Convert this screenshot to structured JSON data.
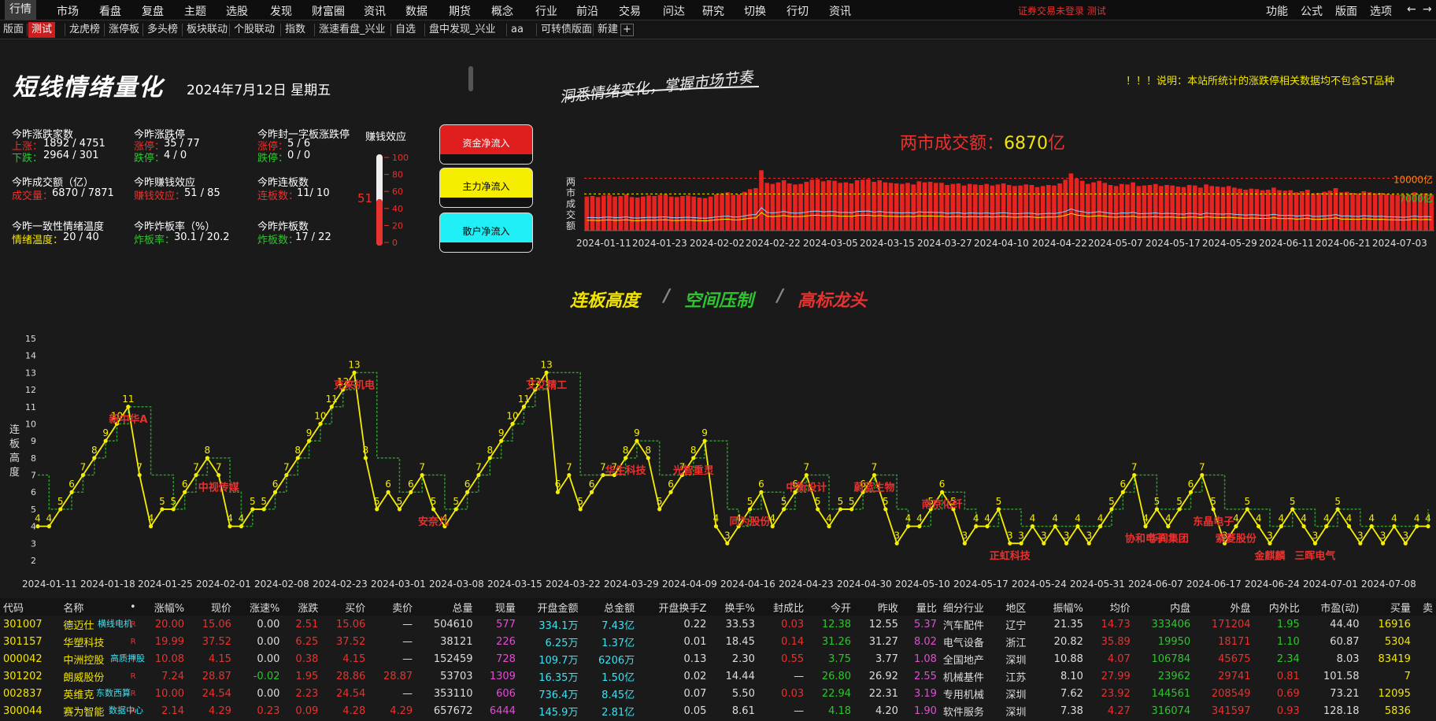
{
  "menubar": {
    "left": [
      "行情",
      "市场",
      "看盘",
      "复盘",
      "主题",
      "选股",
      "发现",
      "财富圈",
      "资讯",
      "数据",
      "期货",
      "概念",
      "行业",
      "前沿",
      "交易",
      "问达",
      "研究",
      "切换",
      "行切",
      "资讯"
    ],
    "status": "证券交易未登录  测试",
    "right": [
      "功能",
      "公式",
      "版面",
      "选项"
    ],
    "back_glyph": "←",
    "fwd_glyph": "→"
  },
  "tabbar": {
    "tabs": [
      "版面",
      "测试",
      "龙虎榜",
      "涨停板",
      "多头榜",
      "板块联动",
      "个股联动",
      "指数",
      "涨速看盘_兴业",
      "自选",
      "盘中发现_兴业",
      "aa",
      "可转债版面",
      "新建"
    ],
    "selected": 1,
    "add_glyph": "+"
  },
  "header": {
    "title": "短线情绪量化",
    "date": "2024年7月12日 星期五",
    "slogan": "洞悉情绪变化，掌握市场节奏",
    "notice": "！！！说明：本站所统计的涨跌停相关数据均不包含ST品种"
  },
  "stats": {
    "rise_fall": {
      "title": "今昨涨跌家数",
      "l1": "上涨：",
      "v1": "1892 / 4751",
      "l2": "下跌：",
      "v2": "2964 / 301"
    },
    "limit": {
      "title": "今昨涨跌停",
      "l1": "涨停：",
      "v1": "35 / 77",
      "l2": "跌停：",
      "v2": "4 / 0"
    },
    "limit_seal": {
      "title": "今昨封一字板涨跌停",
      "l1": "涨停：",
      "v1": "5 / 6",
      "l2": "跌停：",
      "v2": "0 / 0"
    },
    "turnover": {
      "title": "今昨成交额（亿）",
      "l1": "成交量：",
      "v1": "6870 / 7871"
    },
    "money_effect": {
      "title": "今昨赚钱效应",
      "l1": "赚钱效应：",
      "v1": "51 / 85"
    },
    "consec": {
      "title": "今昨连板数",
      "l1": "连板数：",
      "v1": "11/ 10"
    },
    "consistency": {
      "title": "今昨一致性情绪温度",
      "l1": "情绪温度：",
      "v1": "20 / 40"
    },
    "broken_rate": {
      "title": "今昨炸板率（%）",
      "l1": "炸板率：",
      "v1": "30.1 / 20.2"
    },
    "broken": {
      "title": "今昨炸板数",
      "l1": "炸板数：",
      "v1": "17 / 22"
    }
  },
  "gauge": {
    "title": "赚钱效应",
    "value": 51,
    "ticks": [
      "100",
      "80",
      "60",
      "40",
      "20",
      "0"
    ],
    "fill_color": "#e8322f"
  },
  "flows": [
    {
      "label": "资金净流入",
      "bg": "#e01e1e",
      "fg": "#ffffff"
    },
    {
      "label": "主力净流入",
      "bg": "#f5ee00",
      "fg": "#000000"
    },
    {
      "label": "散户净流入",
      "bg": "#1ef0f5",
      "fg": "#000000"
    }
  ],
  "sections": {
    "t1": "连板高度",
    "sep": "/",
    "t2": "空间压制",
    "t3": "高标龙头"
  },
  "chart_data": [
    {
      "type": "bar",
      "title": "两市成交额：",
      "title_value": "6870",
      "title_unit": "亿",
      "ylabel": "两市成交额",
      "ref_lines": [
        {
          "value": 10000,
          "label": "10000亿"
        },
        {
          "value": 7000,
          "label": "7000亿"
        }
      ],
      "ylim": [
        0,
        12000
      ],
      "x_ticks": [
        "2024-01-11",
        "2024-01-23",
        "2024-02-02",
        "2024-02-22",
        "2024-03-05",
        "2024-03-15",
        "2024-03-27",
        "2024-04-10",
        "2024-04-22",
        "2024-05-07",
        "2024-05-17",
        "2024-05-29",
        "2024-06-11",
        "2024-06-21",
        "2024-07-03"
      ],
      "values": [
        6500,
        6600,
        6400,
        6700,
        6800,
        6500,
        6600,
        6900,
        6400,
        6300,
        6500,
        6700,
        6600,
        6800,
        6900,
        6500,
        6400,
        6600,
        6700,
        6500,
        6300,
        6200,
        6500,
        6900,
        7100,
        7300,
        6800,
        6900,
        7400,
        7900,
        8100,
        11500,
        9100,
        8900,
        9200,
        9600,
        9000,
        8800,
        8900,
        9300,
        9700,
        9800,
        9400,
        9600,
        9500,
        9100,
        9200,
        9000,
        9600,
        9700,
        9800,
        9300,
        9600,
        9200,
        9100,
        9000,
        8900,
        9100,
        8800,
        9400,
        9200,
        9300,
        9100,
        9100,
        8700,
        8900,
        9000,
        8600,
        8900,
        8800,
        8700,
        8900,
        8600,
        8800,
        9000,
        8700,
        8500,
        8600,
        8800,
        8700,
        8300,
        8500,
        8700,
        8600,
        9000,
        9700,
        10900,
        9900,
        9500,
        8900,
        9200,
        9500,
        9100,
        8700,
        8500,
        8900,
        8800,
        9200,
        8500,
        8600,
        8700,
        8900,
        8500,
        8700,
        8600,
        8400,
        8300,
        8700,
        8600,
        8200,
        8800,
        8500,
        8400,
        8300,
        8500,
        8200,
        8000,
        7800,
        8000,
        7900,
        7700,
        7800,
        8200,
        7700,
        7600,
        7700,
        7300,
        7500,
        7800,
        7100,
        7200,
        7400,
        7600,
        8100,
        7300,
        7400,
        7200,
        7100,
        7500,
        7300,
        7100,
        7200,
        7000,
        6900,
        6800,
        6700,
        6900,
        7300,
        6900,
        7100,
        6870
      ]
    },
    {
      "type": "line",
      "ylabel": "连板高度",
      "ylim": [
        2,
        15
      ],
      "y_ticks": [
        "15",
        "14",
        "13",
        "12",
        "11",
        "10",
        "9",
        "8",
        "7",
        "6",
        "5",
        "4",
        "3",
        "2"
      ],
      "x_ticks": [
        "2024-01-11",
        "2024-01-18",
        "2024-01-25",
        "2024-02-01",
        "2024-02-08",
        "2024-02-23",
        "2024-03-01",
        "2024-03-08",
        "2024-03-15",
        "2024-03-22",
        "2024-03-29",
        "2024-04-09",
        "2024-04-16",
        "2024-04-23",
        "2024-04-30",
        "2024-05-10",
        "2024-05-17",
        "2024-05-24",
        "2024-05-31",
        "2024-06-07",
        "2024-06-17",
        "2024-06-24",
        "2024-07-01",
        "2024-07-08"
      ],
      "series": [
        {
          "color": "#f5ee00",
          "values": [
            4,
            4,
            5,
            6,
            7,
            8,
            9,
            10,
            11,
            7,
            4,
            5,
            5,
            6,
            7,
            8,
            7,
            4,
            4,
            5,
            5,
            6,
            7,
            8,
            9,
            10,
            11,
            12,
            13,
            8,
            5,
            6,
            5,
            6,
            7,
            5,
            4,
            5,
            6,
            7,
            8,
            9,
            10,
            11,
            12,
            13,
            6,
            7,
            5,
            6,
            7,
            7,
            8,
            9,
            8,
            5,
            6,
            7,
            8,
            9,
            4,
            3,
            4,
            5,
            6,
            4,
            5,
            6,
            7,
            5,
            4,
            5,
            5,
            6,
            7,
            5,
            3,
            4,
            4,
            5,
            6,
            5,
            3,
            4,
            4,
            5,
            3,
            3,
            4,
            3,
            4,
            3,
            4,
            3,
            4,
            5,
            6,
            7,
            4,
            5,
            4,
            5,
            6,
            7,
            5,
            3,
            4,
            5,
            4,
            3,
            4,
            5,
            4,
            3,
            4,
            5,
            4,
            3,
            4,
            3,
            4,
            3,
            4,
            4
          ]
        },
        {
          "color": "#2a9a2a",
          "values": [
            7,
            5,
            5,
            6,
            7,
            8,
            9,
            10,
            11,
            11,
            7,
            7,
            5,
            6,
            7,
            8,
            8,
            6,
            4,
            5,
            5,
            6,
            7,
            8,
            9,
            10,
            11,
            12,
            13,
            13,
            8,
            8,
            6,
            6,
            7,
            7,
            5,
            5,
            6,
            7,
            8,
            9,
            10,
            11,
            12,
            13,
            13,
            13,
            7,
            7,
            7,
            7,
            8,
            9,
            9,
            7,
            7,
            7,
            8,
            9,
            9,
            5,
            4,
            5,
            6,
            6,
            5,
            6,
            7,
            7,
            5,
            5,
            5,
            6,
            7,
            7,
            5,
            4,
            4,
            5,
            6,
            6,
            5,
            4,
            4,
            5,
            5,
            4,
            4,
            4,
            4,
            4,
            4,
            4,
            4,
            5,
            6,
            7,
            7,
            5,
            5,
            5,
            6,
            7,
            7,
            5,
            5,
            5,
            5,
            4,
            4,
            5,
            5,
            4,
            4,
            5,
            5,
            4,
            4,
            4,
            4,
            4,
            4,
            5
          ]
        }
      ],
      "labels": [
        {
          "i": 8,
          "text": "新中华A"
        },
        {
          "i": 16,
          "text": "中视传媒"
        },
        {
          "i": 28,
          "text": "克来机电"
        },
        {
          "i": 35,
          "text": "安奈儿"
        },
        {
          "i": 45,
          "text": "艾艾精工"
        },
        {
          "i": 52,
          "text": "华生科技"
        },
        {
          "i": 58,
          "text": "光智重灵"
        },
        {
          "i": 63,
          "text": "同为股份"
        },
        {
          "i": 68,
          "text": "中衡设计"
        },
        {
          "i": 74,
          "text": "蔚蓝生物"
        },
        {
          "i": 80,
          "text": "南京化纤"
        },
        {
          "i": 86,
          "text": "正虹科技"
        },
        {
          "i": 98,
          "text": "协和电子"
        },
        {
          "i": 100,
          "text": "华闻集团"
        },
        {
          "i": 104,
          "text": "东晶电子"
        },
        {
          "i": 106,
          "text": "索菱股份"
        },
        {
          "i": 109,
          "text": "金麒麟"
        },
        {
          "i": 113,
          "text": "三晖电气"
        }
      ]
    }
  ],
  "table": {
    "headers": [
      "代码",
      "名称",
      "•",
      "涨幅%",
      "现价",
      "涨速%",
      "涨跌",
      "买价",
      "卖价",
      "总量",
      "现量",
      "开盘金额",
      "总金额",
      "开盘换手Z",
      "换手%",
      "封成比",
      "今开",
      "昨收",
      "量比",
      "细分行业",
      "地区",
      "振幅%",
      "均价",
      "内盘",
      "外盘",
      "内外比",
      "市盈(动)",
      "买量",
      "卖"
    ],
    "overlays": [
      "横线电机",
      "高质押股",
      "东数西算",
      "数据中心"
    ],
    "rows": [
      [
        "301007",
        "德迈仕",
        "R",
        "20.00",
        "15.06",
        "0.00",
        "2.51",
        "15.06",
        "—",
        "504610",
        "577",
        "334.1万",
        "7.43亿",
        "0.22",
        "33.53",
        "0.03",
        "12.38",
        "12.55",
        "5.37",
        "汽车配件",
        "辽宁",
        "21.35",
        "14.73",
        "333406",
        "171204",
        "1.95",
        "44.40",
        "16916"
      ],
      [
        "301157",
        "华塑科技",
        "R",
        "19.99",
        "37.52",
        "0.00",
        "6.25",
        "37.52",
        "—",
        "38121",
        "226",
        "6.25万",
        "1.37亿",
        "0.01",
        "18.45",
        "0.14",
        "31.26",
        "31.27",
        "8.02",
        "电气设备",
        "浙江",
        "20.82",
        "35.89",
        "19950",
        "18171",
        "1.10",
        "60.87",
        "5304"
      ],
      [
        "000042",
        "中洲控股",
        "R",
        "10.08",
        "4.15",
        "0.00",
        "0.38",
        "4.15",
        "—",
        "152459",
        "728",
        "109.7万",
        "6206万",
        "0.13",
        "2.30",
        "0.55",
        "3.75",
        "3.77",
        "1.08",
        "全国地产",
        "深圳",
        "10.88",
        "4.07",
        "106784",
        "45675",
        "2.34",
        "8.03",
        "83419"
      ],
      [
        "301202",
        "朗威股份",
        "R",
        "7.24",
        "28.87",
        "-0.02",
        "1.95",
        "28.86",
        "28.87",
        "53703",
        "1309",
        "16.35万",
        "1.50亿",
        "0.02",
        "14.44",
        "—",
        "26.80",
        "26.92",
        "2.55",
        "机械基件",
        "江苏",
        "8.10",
        "27.99",
        "23962",
        "29741",
        "0.81",
        "101.58",
        "7"
      ],
      [
        "002837",
        "英维克",
        "R",
        "10.00",
        "24.54",
        "0.00",
        "2.23",
        "24.54",
        "—",
        "353110",
        "606",
        "736.4万",
        "8.45亿",
        "0.07",
        "5.50",
        "0.03",
        "22.94",
        "22.31",
        "3.19",
        "专用机械",
        "深圳",
        "7.62",
        "23.92",
        "144561",
        "208549",
        "0.69",
        "73.21",
        "12095"
      ],
      [
        "300044",
        "赛为智能",
        "R",
        "2.14",
        "4.29",
        "0.23",
        "0.09",
        "4.28",
        "4.29",
        "657672",
        "6444",
        "145.9万",
        "2.81亿",
        "0.05",
        "8.61",
        "—",
        "4.18",
        "4.20",
        "1.90",
        "软件服务",
        "深圳",
        "7.38",
        "4.27",
        "316074",
        "341597",
        "0.93",
        "128.18",
        "5836"
      ]
    ]
  }
}
